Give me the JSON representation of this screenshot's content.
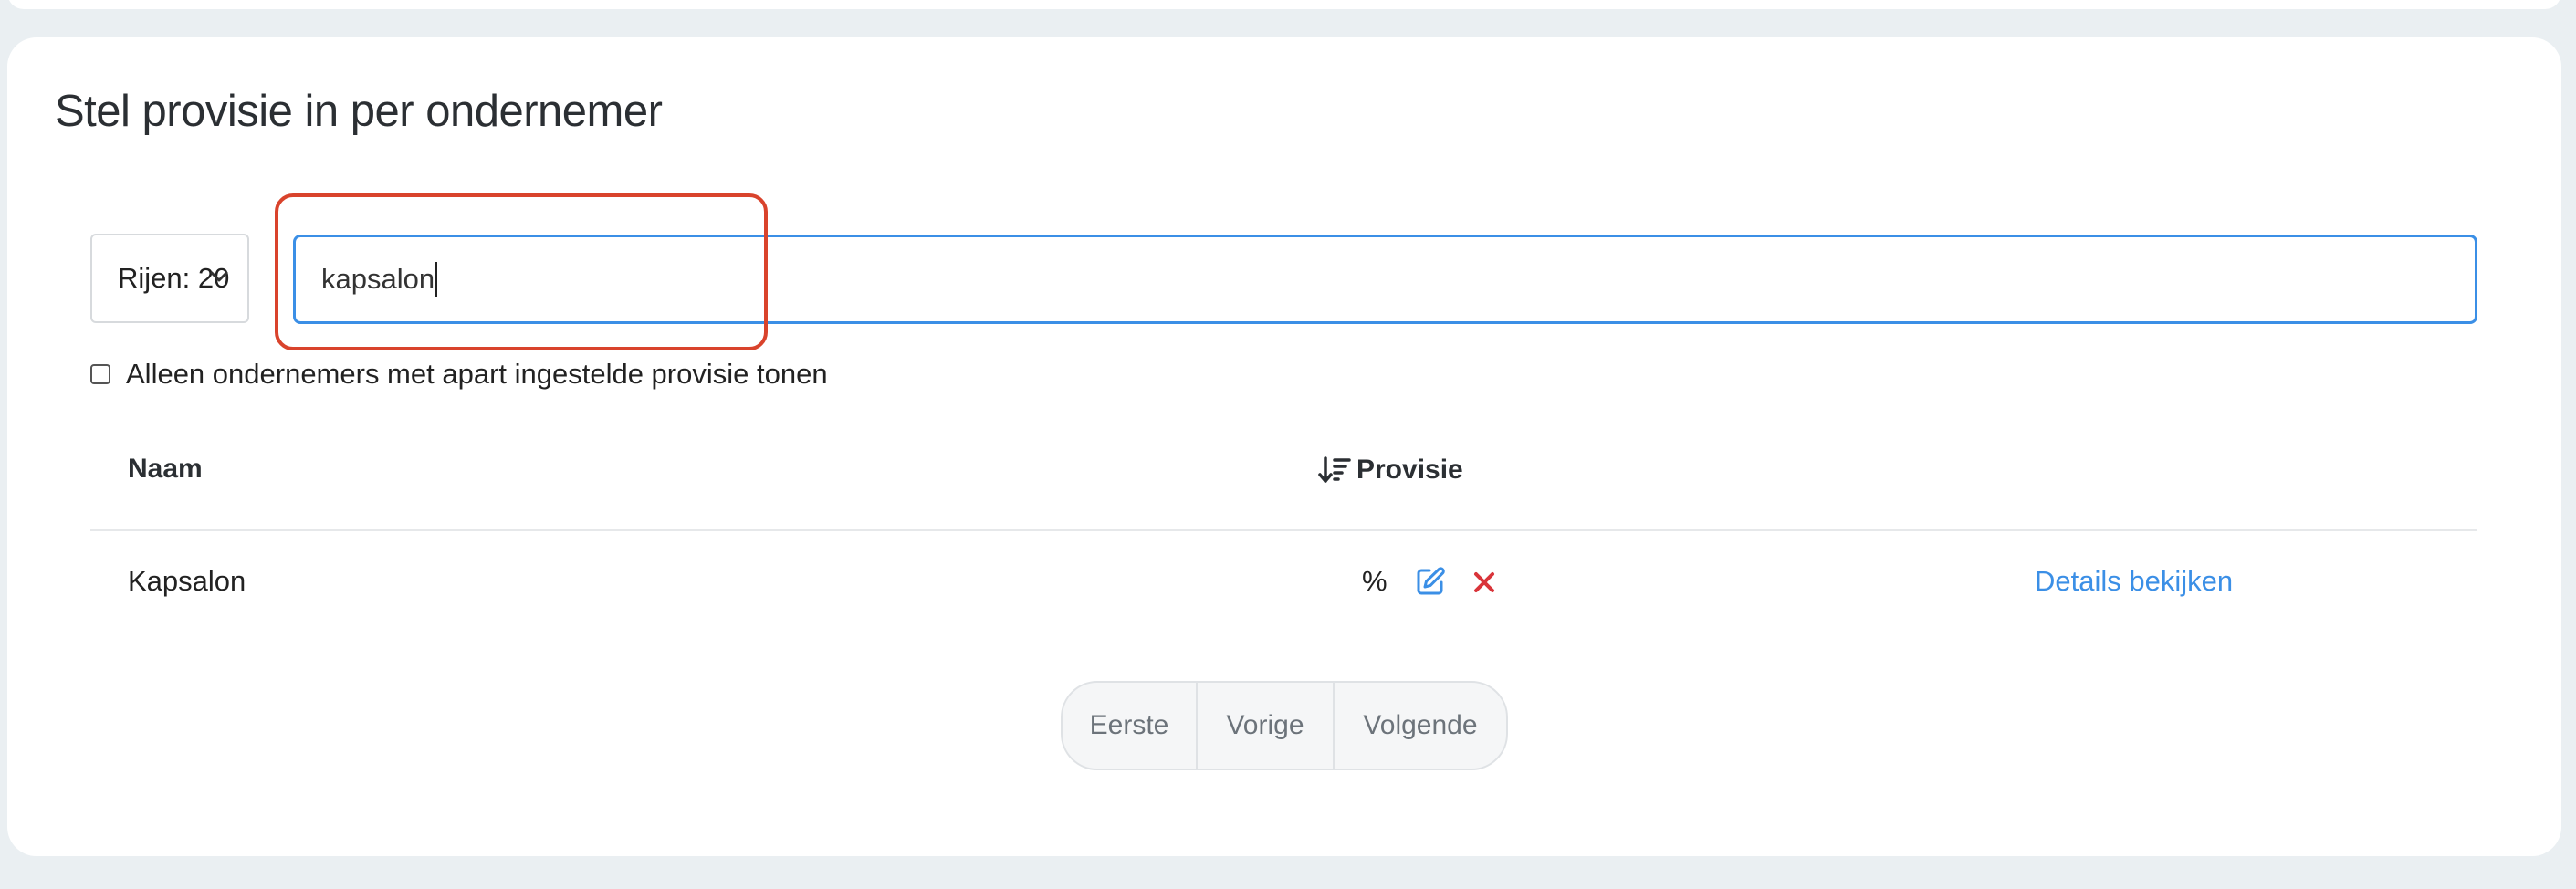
{
  "section": {
    "title": "Stel provisie in per ondernemer"
  },
  "controls": {
    "rows_select_label": "Rijen: 20",
    "search_value": "kapsalon",
    "checkbox_label": "Alleen ondernemers met apart ingestelde provisie tonen",
    "checkbox_checked": false
  },
  "table": {
    "headers": {
      "naam": "Naam",
      "provisie": "Provisie"
    },
    "rows": [
      {
        "naam": "Kapsalon",
        "provisie": "%",
        "action_edit_icon": "edit-icon",
        "action_delete_icon": "delete-icon",
        "details_link": "Details bekijken"
      }
    ]
  },
  "pagination": {
    "first": "Eerste",
    "previous": "Vorige",
    "next": "Volgende"
  },
  "colors": {
    "accent": "#3b8fe6",
    "danger": "#d9343a",
    "highlight": "#d9432c",
    "background": "#eaeff2"
  }
}
